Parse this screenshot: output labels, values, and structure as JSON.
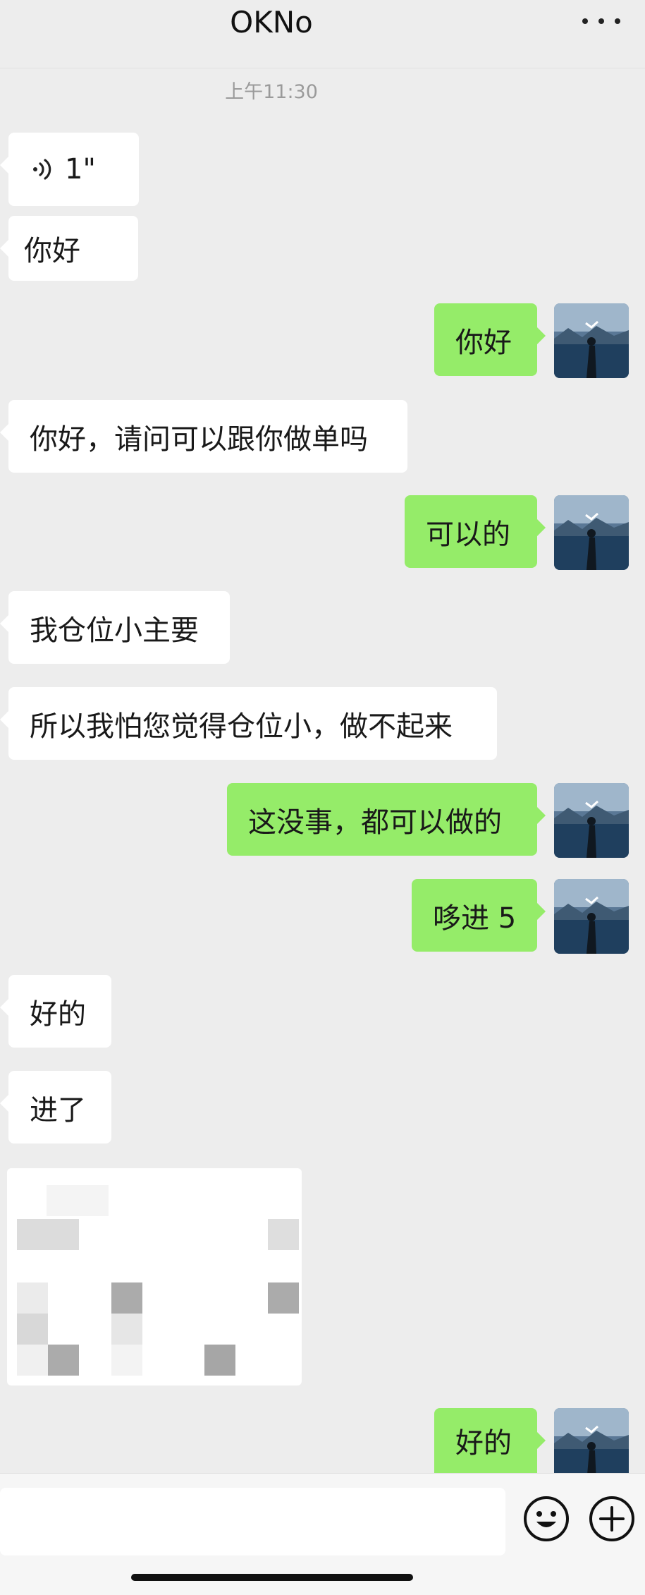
{
  "header": {
    "title": "OKNo",
    "more_icon": "more-horizontal-icon"
  },
  "timestamp": "上午11:30",
  "messages": [
    {
      "side": "in",
      "type": "voice",
      "duration": "1\""
    },
    {
      "side": "in",
      "type": "text",
      "text": "你好"
    },
    {
      "side": "out",
      "type": "text",
      "text": "你好"
    },
    {
      "side": "in",
      "type": "text",
      "text": "你好，请问可以跟你做单吗"
    },
    {
      "side": "out",
      "type": "text",
      "text": "可以的"
    },
    {
      "side": "in",
      "type": "text",
      "text": "我仓位小主要"
    },
    {
      "side": "in",
      "type": "text",
      "text": "所以我怕您觉得仓位小，做不起来"
    },
    {
      "side": "out",
      "type": "text",
      "text": "这没事，都可以做的"
    },
    {
      "side": "out",
      "type": "text",
      "text": "哆进 5"
    },
    {
      "side": "in",
      "type": "text",
      "text": "好的"
    },
    {
      "side": "in",
      "type": "text",
      "text": "进了"
    },
    {
      "side": "in",
      "type": "image",
      "note": "pixelated-screenshot"
    },
    {
      "side": "out",
      "type": "text",
      "text": "好的"
    }
  ],
  "input_bar": {
    "placeholder": "",
    "emoji_icon": "emoji-icon",
    "plus_icon": "plus-circle-icon"
  },
  "colors": {
    "background": "#ededed",
    "incoming_bubble": "#ffffff",
    "outgoing_bubble": "#95ec69"
  }
}
